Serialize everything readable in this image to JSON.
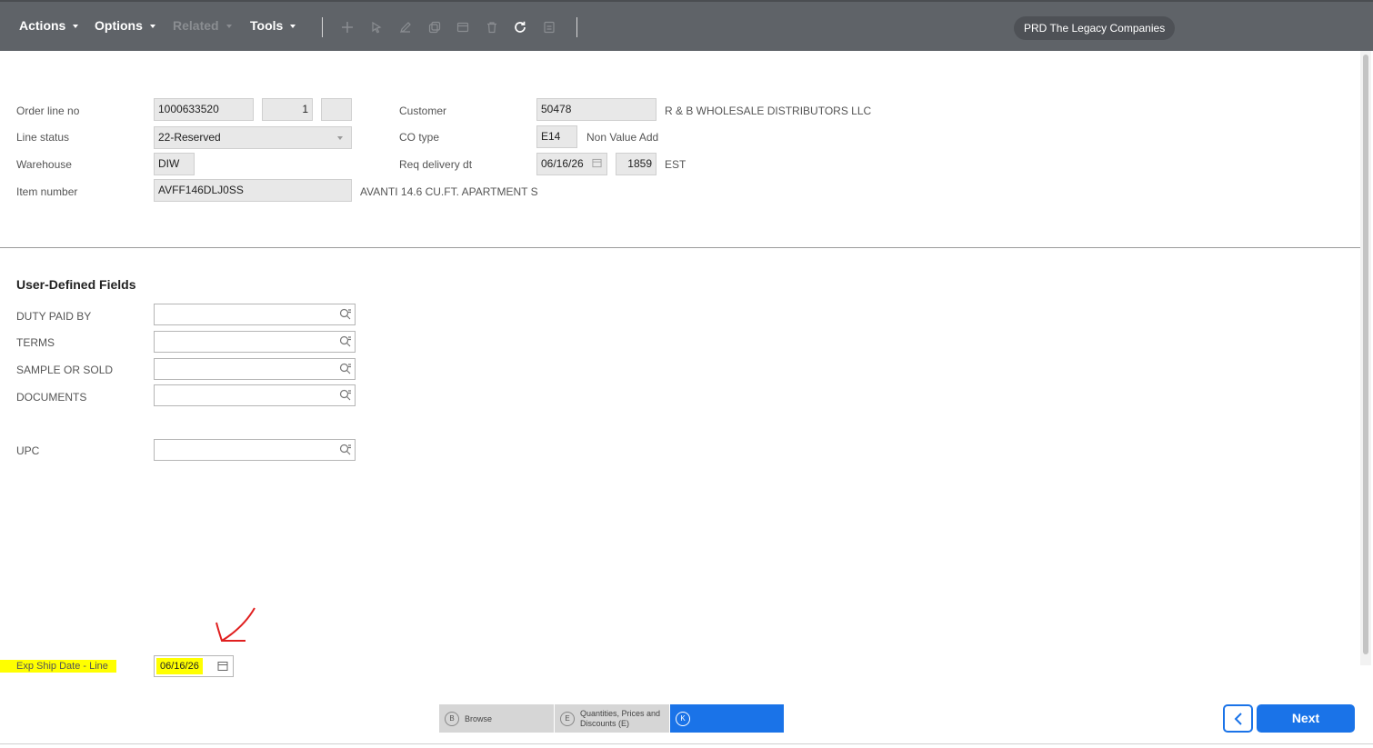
{
  "toolbar": {
    "menus": {
      "actions": "Actions",
      "options": "Options",
      "related": "Related",
      "tools": "Tools"
    },
    "icons": [
      "add-icon",
      "cursor-icon",
      "edit-icon",
      "copy-icon",
      "window-icon",
      "delete-icon",
      "refresh-icon",
      "form-icon"
    ],
    "environment": "PRD The Legacy Companies"
  },
  "header": {
    "order_line_no": {
      "label": "Order line no",
      "order": "1000633520",
      "line": "1",
      "suffix": ""
    },
    "line_status": {
      "label": "Line status",
      "value": "22-Reserved"
    },
    "warehouse": {
      "label": "Warehouse",
      "value": "DIW"
    },
    "item_number": {
      "label": "Item number",
      "value": "AVFF146DLJ0SS",
      "description": "AVANTI 14.6 CU.FT. APARTMENT S"
    },
    "customer": {
      "label": "Customer",
      "value": "50478",
      "name": "R & B WHOLESALE DISTRIBUTORS LLC"
    },
    "co_type": {
      "label": "CO type",
      "value": "E14",
      "description": "Non Value Add"
    },
    "req_delivery": {
      "label": "Req delivery dt",
      "date": "06/16/26",
      "time": "1859",
      "zone": "EST"
    }
  },
  "udf": {
    "title": "User-Defined Fields",
    "fields": [
      {
        "label": "DUTY PAID BY",
        "value": ""
      },
      {
        "label": "TERMS",
        "value": ""
      },
      {
        "label": "SAMPLE OR SOLD",
        "value": ""
      },
      {
        "label": "DOCUMENTS",
        "value": ""
      },
      {
        "label": "UPC",
        "value": ""
      }
    ]
  },
  "exp_ship": {
    "label": "Exp Ship Date - Line",
    "value": "06/16/26"
  },
  "footer": {
    "tabs": [
      {
        "key": "B",
        "label": "Browse"
      },
      {
        "key": "E",
        "label": "Quantities, Prices and Discounts (E)"
      },
      {
        "key": "K",
        "label": ""
      }
    ],
    "next_label": "Next"
  },
  "colors": {
    "accent": "#1a73e8",
    "toolbar": "#5f6368",
    "highlight": "#ffff00",
    "annotation": "#e02020"
  }
}
